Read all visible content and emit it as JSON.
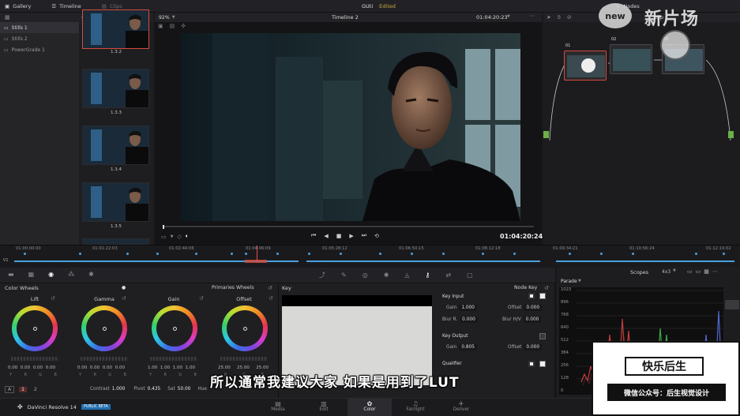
{
  "topbar": {
    "gallery": "Gallery",
    "timeline": "Timeline",
    "clips": "Clips",
    "project": "GUti",
    "status": "Edited",
    "nodes": "Nodes"
  },
  "stills": {
    "items": [
      "Stills 1",
      "Stills 2",
      "PowerGrade 1"
    ],
    "thumbs": [
      "1.3.2",
      "1.3.3",
      "1.3.4",
      "1.3.5"
    ]
  },
  "viewer": {
    "zoom": "92%",
    "timeline_name": "Timeline 2",
    "timecode_top": "01:04:20:23",
    "timecode": "01:04:20:24"
  },
  "nodes": {
    "labels": [
      "01",
      "02",
      "03"
    ],
    "clip_label": "Clip"
  },
  "timeline": {
    "timecodes": [
      "01:00:00:00",
      "01:01:22:03",
      "01:02:44:06",
      "01:04:06:09",
      "01:05:28:12",
      "01:06:50:15",
      "01:08:12:18",
      "01:09:34:21",
      "01:10:56:24",
      "01:12:19:02"
    ],
    "track": "V1"
  },
  "wheels": {
    "title": "Color Wheels",
    "mode": "Primaries Wheels",
    "items": [
      {
        "name": "Lift",
        "values": [
          "0.00",
          "0.00",
          "0.00",
          "0.00"
        ]
      },
      {
        "name": "Gamma",
        "values": [
          "0.00",
          "0.00",
          "0.00",
          "0.00"
        ]
      },
      {
        "name": "Gain",
        "values": [
          "1.00",
          "1.00",
          "1.00",
          "1.00"
        ]
      },
      {
        "name": "Offset",
        "values": [
          "25.00",
          "25.00",
          "25.00"
        ]
      }
    ],
    "channels_ybrg": [
      "Y",
      "R",
      "G",
      "B"
    ],
    "channels_rgb": [
      "R",
      "G",
      "B"
    ],
    "page_a": "A",
    "page_1": "1",
    "page_2": "2",
    "contrast_label": "Contrast",
    "contrast": "1.000",
    "pivot_label": "Pivot",
    "pivot": "0.435",
    "sat_label": "Sat",
    "sat": "50.00",
    "hue_label": "Hue"
  },
  "key": {
    "title": "Key",
    "node_key": "Node Key",
    "key_input": "Key Input",
    "gain_label": "Gain",
    "gain_in": "1.000",
    "offset_label": "Offset",
    "offset_in": "0.000",
    "blur_r_label": "Blur R.",
    "blur_r": "0.000",
    "blur_hv_label": "Blur H/V",
    "blur_hv": "0.000",
    "key_output": "Key Output",
    "gain_out": "0.805",
    "offset_out": "0.000",
    "qualifier": "Qualifier"
  },
  "scopes": {
    "title": "Scopes",
    "layout": "4x3",
    "mode": "Parade",
    "ticks": [
      "1023",
      "896",
      "768",
      "640",
      "512",
      "384",
      "256",
      "128",
      "0"
    ]
  },
  "bottombar": {
    "app": "DaVinci Resolve 14",
    "badge": "PUBLIC BETA",
    "pages": [
      "Media",
      "Edit",
      "Color",
      "Fairlight",
      "Deliver"
    ]
  },
  "overlay": {
    "subtitle": "所以通常我建议大家 如果是用到了LUT",
    "watermark_badge": "new",
    "watermark_brand": "新片场",
    "watermark_title": "快乐后生",
    "watermark_sub": "微信公众号：后生视觉设计"
  },
  "colors": {
    "accent": "#d64b3c",
    "playhead": "#e05050",
    "track": "#4aa0e0"
  }
}
